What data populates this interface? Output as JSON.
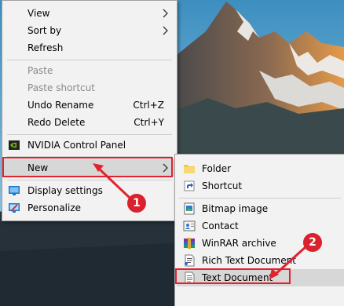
{
  "main_menu": {
    "view": "View",
    "sort_by": "Sort by",
    "refresh": "Refresh",
    "paste": "Paste",
    "paste_shortcut": "Paste shortcut",
    "undo_rename": "Undo Rename",
    "undo_rename_shortcut": "Ctrl+Z",
    "redo_delete": "Redo Delete",
    "redo_delete_shortcut": "Ctrl+Y",
    "nvidia": "NVIDIA Control Panel",
    "new": "New",
    "display_settings": "Display settings",
    "personalize": "Personalize"
  },
  "sub_menu": {
    "folder": "Folder",
    "shortcut": "Shortcut",
    "bitmap": "Bitmap image",
    "contact": "Contact",
    "winrar": "WinRAR archive",
    "rich_text": "Rich Text Document",
    "text_document": "Text Document"
  },
  "annotations": {
    "step1": "1",
    "step2": "2"
  },
  "colors": {
    "menu_bg": "#f2f2f2",
    "highlight": "#d7d7d7",
    "annotation_red": "#e0232e"
  }
}
